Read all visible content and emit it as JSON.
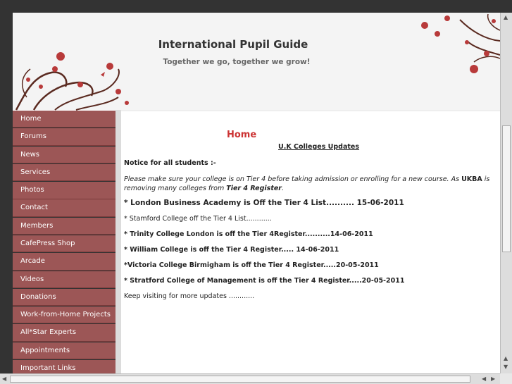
{
  "header": {
    "title": "International Pupil Guide",
    "tagline": "Together we go, together we grow!"
  },
  "sidebar": {
    "items": [
      {
        "label": "Home"
      },
      {
        "label": "Forums"
      },
      {
        "label": "News"
      },
      {
        "label": "Services"
      },
      {
        "label": "Photos"
      },
      {
        "label": "Contact"
      },
      {
        "label": "Members"
      },
      {
        "label": "CafePress Shop"
      },
      {
        "label": "Arcade"
      },
      {
        "label": "Videos"
      },
      {
        "label": "Donations"
      },
      {
        "label": "Work-from-Home Projects"
      },
      {
        "label": "All*Star Experts"
      },
      {
        "label": "Appointments"
      },
      {
        "label": "Important Links"
      }
    ]
  },
  "main": {
    "page_title": "Home",
    "section_title": "U.K  Colleges Updates",
    "notice": "Notice for all students :-",
    "paragraph_part1": "Please make sure your college is on Tier 4 before taking admission or enrolling for a new course. As ",
    "paragraph_ukba": "UKBA",
    "paragraph_part2": " is removing many colleges from ",
    "paragraph_tier": "Tier 4 Register",
    "paragraph_end": ".",
    "updates": [
      "* London Business Academy is Off the Tier 4 List.......... 15-06-2011",
      "* Stamford College off the Tier 4 List............",
      "* Trinity College London is off the Tier 4Register..........14-06-2011",
      "* William College is off the Tier 4 Register..... 14-06-2011",
      "*Victoria College Birmigham is off the Tier 4 Register.....20-05-2011",
      "* Stratford College of Management is off the Tier 4 Register.....20-05-2011"
    ],
    "footer_note": "Keep visiting for more updates ............"
  },
  "colors": {
    "nav_bg": "#9c5656",
    "accent_red": "#cc3333",
    "page_bg": "#333333"
  }
}
